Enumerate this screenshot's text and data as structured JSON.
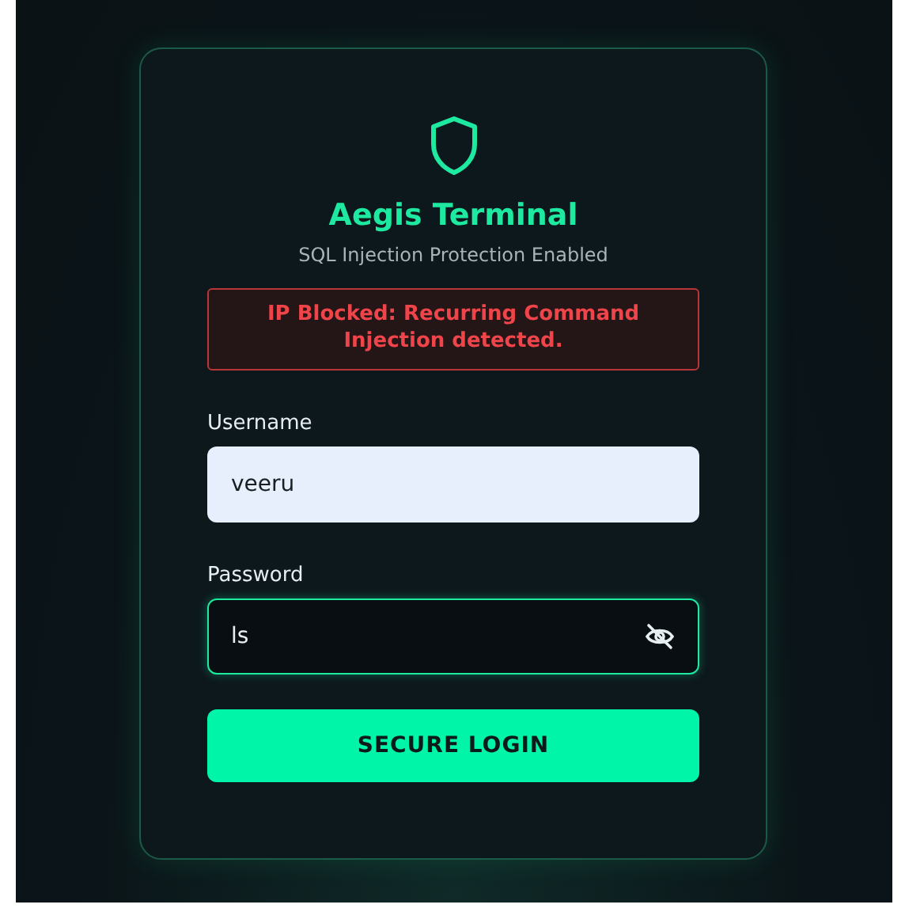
{
  "brand": {
    "title": "Aegis Terminal",
    "subtitle": "SQL Injection Protection Enabled"
  },
  "alert": {
    "message": "IP Blocked: Recurring Command Injection detected."
  },
  "fields": [
    {
      "label": "Username",
      "value": "veeru",
      "kind": "text",
      "focused": false
    },
    {
      "label": "Password",
      "value": "ls",
      "kind": "password",
      "focused": true
    }
  ],
  "button": {
    "label": "SECURE LOGIN"
  }
}
